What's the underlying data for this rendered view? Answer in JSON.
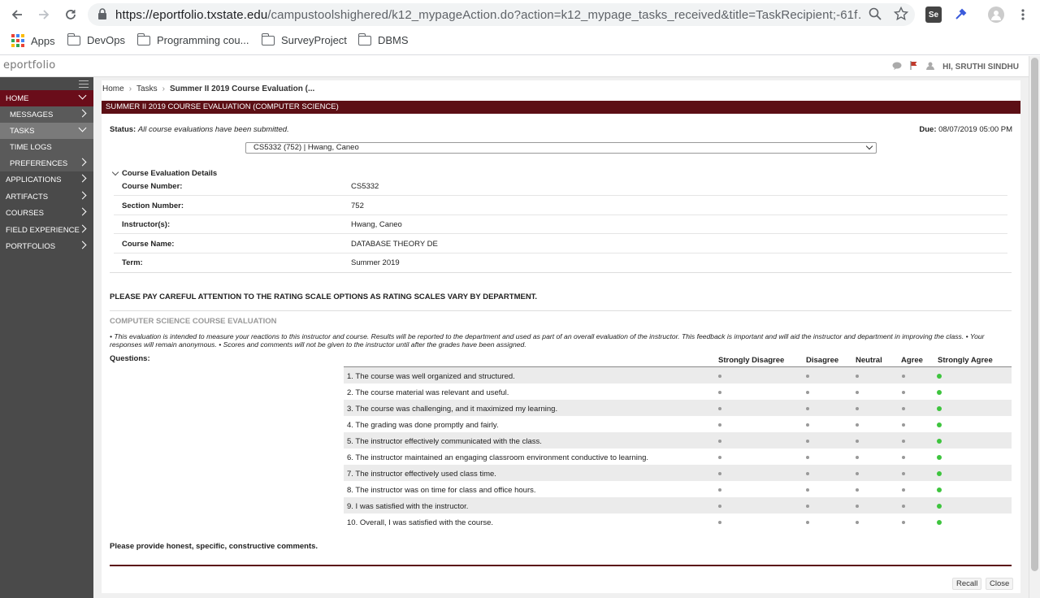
{
  "browser": {
    "url_host": "https://eportfolio.txstate.edu",
    "url_rest": "/campustoolshighered/k12_mypageAction.do?action=k12_mypage_tasks_received&title=TaskRecipient;-61f…",
    "bookmarks": [
      "Apps",
      "DevOps",
      "Programming cou...",
      "SurveyProject",
      "DBMS"
    ],
    "ext_label": "Se"
  },
  "header": {
    "logo": "eportfolio",
    "user": "HI, SRUTHI SINDHU"
  },
  "sidebar": {
    "items": [
      {
        "label": "HOME"
      },
      {
        "label": "MESSAGES"
      },
      {
        "label": "TASKS"
      },
      {
        "label": "TIME LOGS"
      },
      {
        "label": "PREFERENCES"
      },
      {
        "label": "APPLICATIONS"
      },
      {
        "label": "ARTIFACTS"
      },
      {
        "label": "COURSES"
      },
      {
        "label": "FIELD EXPERIENCE"
      },
      {
        "label": "PORTFOLIOS"
      }
    ]
  },
  "breadcrumb": {
    "home": "Home",
    "tasks": "Tasks",
    "current": "Summer II 2019 Course Evaluation (..."
  },
  "page_title": "SUMMER II 2019 COURSE EVALUATION (COMPUTER SCIENCE)",
  "status": {
    "label": "Status:",
    "value": "All course evaluations have been submitted.",
    "due_label": "Due:",
    "due_value": "08/07/2019 05:00 PM"
  },
  "course_select": "CS5332 (752) | Hwang, Caneo",
  "details": {
    "heading": "Course Evaluation Details",
    "rows": [
      {
        "key": "Course Number:",
        "value": "CS5332"
      },
      {
        "key": "Section Number:",
        "value": "752"
      },
      {
        "key": "Instructor(s):",
        "value": "Hwang, Caneo"
      },
      {
        "key": "Course Name:",
        "value": "DATABASE THEORY DE"
      },
      {
        "key": "Term:",
        "value": "Summer 2019"
      }
    ]
  },
  "notice": "PLEASE PAY CAREFUL ATTENTION TO THE RATING SCALE OPTIONS AS RATING SCALES VARY BY DEPARTMENT.",
  "evaluation": {
    "title": "COMPUTER SCIENCE COURSE EVALUATION",
    "intro": "• This evaluation is intended to measure your reactions to this instructor and course. Results will be reported to the department and used as part of an overall evaluation of the instructor. This feedback is important and will aid the instructor and department in improving the class. • Your responses will remain anonymous. • Scores and comments will not be given to the instructor until after the grades have been assigned.",
    "questions_label": "Questions:",
    "scale": [
      "Strongly Disagree",
      "Disagree",
      "Neutral",
      "Agree",
      "Strongly Agree"
    ],
    "questions": [
      {
        "text": "1. The course was well organized and structured.",
        "selected": 4
      },
      {
        "text": "2. The course material was relevant and useful.",
        "selected": 4
      },
      {
        "text": "3. The course was challenging, and it maximized my learning.",
        "selected": 4
      },
      {
        "text": "4. The grading was done promptly and fairly.",
        "selected": 4
      },
      {
        "text": "5. The instructor effectively communicated with the class.",
        "selected": 4
      },
      {
        "text": "6. The instructor maintained an engaging classroom environment conductive to learning.",
        "selected": 4
      },
      {
        "text": "7. The instructor effectively used class time.",
        "selected": 4
      },
      {
        "text": "8. The instructor was on time for class and office hours.",
        "selected": 4
      },
      {
        "text": "9. I was satisfied with the instructor.",
        "selected": 4
      },
      {
        "text": "10. Overall, I was satisfied with the course.",
        "selected": 4
      }
    ],
    "comments_label": "Please provide honest, specific, constructive comments."
  },
  "buttons": {
    "recall": "Recall",
    "close": "Close"
  },
  "colors": {
    "accent": "#5c0f15",
    "selected_dot": "#3ec43e"
  }
}
